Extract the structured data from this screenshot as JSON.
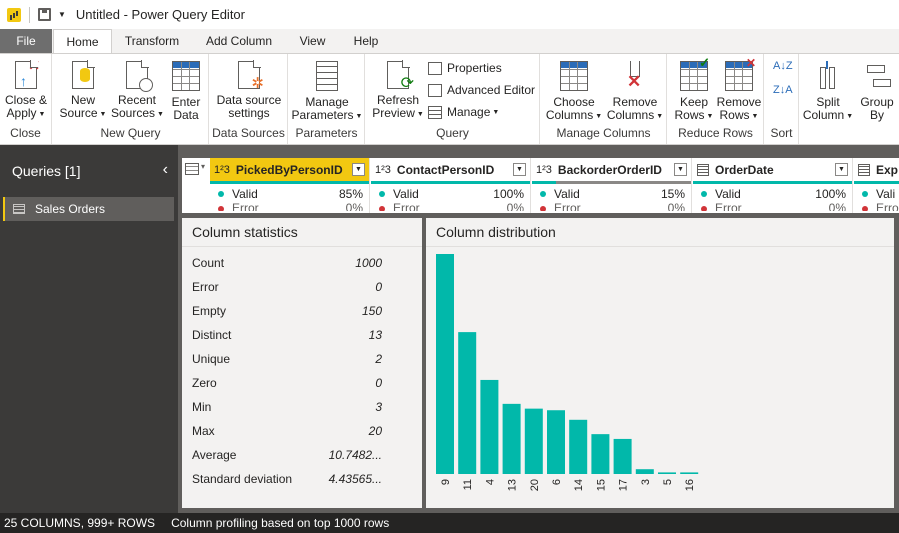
{
  "window": {
    "title": "Untitled - Power Query Editor"
  },
  "tabs": [
    "File",
    "Home",
    "Transform",
    "Add Column",
    "View",
    "Help"
  ],
  "ribbon": {
    "close": {
      "button": [
        "Close &",
        "Apply"
      ],
      "label": "Close"
    },
    "new_query": {
      "new_source": [
        "New",
        "Source"
      ],
      "recent_sources": [
        "Recent",
        "Sources"
      ],
      "enter_data": [
        "Enter",
        "Data"
      ],
      "label": "New Query"
    },
    "data_sources": {
      "button": [
        "Data source",
        "settings"
      ],
      "label": "Data Sources"
    },
    "parameters": {
      "button": [
        "Manage",
        "Parameters"
      ],
      "label": "Parameters"
    },
    "query": {
      "refresh": [
        "Refresh",
        "Preview"
      ],
      "properties": "Properties",
      "advanced_editor": "Advanced Editor",
      "manage": "Manage",
      "label": "Query"
    },
    "manage_columns": {
      "choose": [
        "Choose",
        "Columns"
      ],
      "remove": [
        "Remove",
        "Columns"
      ],
      "label": "Manage Columns"
    },
    "reduce_rows": {
      "keep": [
        "Keep",
        "Rows"
      ],
      "remove": [
        "Remove",
        "Rows"
      ],
      "label": "Reduce Rows"
    },
    "sort": {
      "label": "Sort",
      "asc": "A↓Z",
      "desc": "Z↓A"
    },
    "split": [
      "Split",
      "Column"
    ],
    "group": [
      "Group",
      "By"
    ]
  },
  "queries": {
    "header": "Queries [1]",
    "items": [
      {
        "label": "Sales Orders"
      }
    ]
  },
  "columns": [
    {
      "type": "1²3",
      "name": "PickedByPersonID",
      "valid": "Valid",
      "valid_pct": "85%",
      "error": "Error",
      "error_pct": "0%",
      "valid_fraction": 0.85
    },
    {
      "type": "1²3",
      "name": "ContactPersonID",
      "valid": "Valid",
      "valid_pct": "100%",
      "error": "Error",
      "error_pct": "0%",
      "valid_fraction": 1.0
    },
    {
      "type": "1²3",
      "name": "BackorderOrderID",
      "valid": "Valid",
      "valid_pct": "15%",
      "error": "Error",
      "error_pct": "0%",
      "valid_fraction": 0.15
    },
    {
      "type": "cal",
      "name": "OrderDate",
      "valid": "Valid",
      "valid_pct": "100%",
      "error": "Error",
      "error_pct": "0%",
      "valid_fraction": 1.0
    },
    {
      "type": "cal",
      "name": "Exp",
      "valid": "Vali",
      "valid_pct": "",
      "error": "Erro",
      "error_pct": "",
      "valid_fraction": 1.0
    }
  ],
  "column_statistics": {
    "title": "Column statistics",
    "rows": [
      {
        "label": "Count",
        "value": "1000"
      },
      {
        "label": "Error",
        "value": "0"
      },
      {
        "label": "Empty",
        "value": "150"
      },
      {
        "label": "Distinct",
        "value": "13"
      },
      {
        "label": "Unique",
        "value": "2"
      },
      {
        "label": "Zero",
        "value": "0"
      },
      {
        "label": "Min",
        "value": "3"
      },
      {
        "label": "Max",
        "value": "20"
      },
      {
        "label": "Average",
        "value": "10.7482..."
      },
      {
        "label": "Standard deviation",
        "value": "4.43565..."
      }
    ]
  },
  "column_distribution": {
    "title": "Column distribution"
  },
  "chart_data": {
    "type": "bar",
    "categories": [
      "9",
      "11",
      "4",
      "13",
      "20",
      "6",
      "14",
      "15",
      "17",
      "3",
      "5",
      "16"
    ],
    "values": [
      138,
      89,
      59,
      44,
      41,
      40,
      34,
      25,
      22,
      3,
      1,
      1
    ],
    "ylim": [
      0,
      138
    ],
    "color": "#01b8aa",
    "grid": false
  },
  "statusbar": {
    "columns": "25 COLUMNS, 999+ ROWS",
    "profiling": "Column profiling based on top 1000 rows"
  },
  "colors": {
    "accent": "#f2c811",
    "teal": "#01b8aa",
    "error": "#d13438"
  }
}
